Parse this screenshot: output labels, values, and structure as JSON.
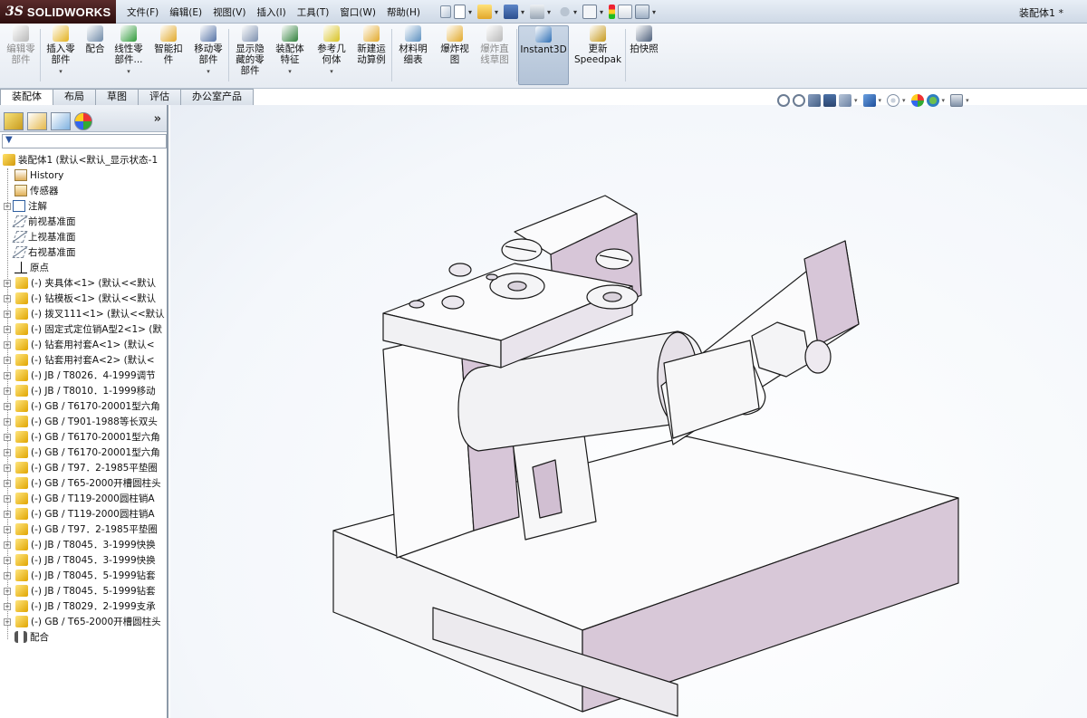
{
  "app": {
    "brand_prefix": "3S",
    "brand_name": "SOLIDWORKS",
    "document_title": "装配体1 *"
  },
  "menu": [
    "文件(F)",
    "编辑(E)",
    "视图(V)",
    "插入(I)",
    "工具(T)",
    "窗口(W)",
    "帮助(H)"
  ],
  "ribbon": {
    "buttons": [
      {
        "label": "编辑零\n部件",
        "enabled": false,
        "icon": "edit-component-icon"
      },
      {
        "label": "插入零\n部件",
        "enabled": true,
        "icon": "insert-component-icon",
        "dropdown": true
      },
      {
        "label": "配合",
        "enabled": true,
        "icon": "mate-icon"
      },
      {
        "label": "线性零\n部件...",
        "enabled": true,
        "icon": "linear-pattern-icon",
        "dropdown": true
      },
      {
        "label": "智能扣\n件",
        "enabled": true,
        "icon": "smart-fasteners-icon"
      },
      {
        "label": "移动零\n部件",
        "enabled": true,
        "icon": "move-component-icon",
        "dropdown": true
      },
      {
        "label": "显示隐\n藏的零\n部件",
        "enabled": true,
        "icon": "show-hidden-icon"
      },
      {
        "label": "装配体\n特征",
        "enabled": true,
        "icon": "assembly-features-icon",
        "dropdown": true
      },
      {
        "label": "参考几\n何体",
        "enabled": true,
        "icon": "reference-geometry-icon",
        "dropdown": true
      },
      {
        "label": "新建运\n动算例",
        "enabled": true,
        "icon": "new-motion-study-icon"
      },
      {
        "label": "材料明\n细表",
        "enabled": true,
        "icon": "bom-icon"
      },
      {
        "label": "爆炸视\n图",
        "enabled": true,
        "icon": "exploded-view-icon"
      },
      {
        "label": "爆炸直\n线草图",
        "enabled": false,
        "icon": "explode-line-sketch-icon"
      },
      {
        "label": "Instant3D",
        "enabled": true,
        "active": true,
        "icon": "instant3d-icon"
      },
      {
        "label": "更新\nSpeedpak",
        "enabled": true,
        "icon": "update-speedpak-icon"
      },
      {
        "label": "拍快照",
        "enabled": true,
        "icon": "snapshot-icon"
      }
    ]
  },
  "tabs": [
    {
      "label": "装配体",
      "active": true
    },
    {
      "label": "布局",
      "active": false
    },
    {
      "label": "草图",
      "active": false
    },
    {
      "label": "评估",
      "active": false
    },
    {
      "label": "办公室产品",
      "active": false
    }
  ],
  "panel": {
    "expand_glyph": "»",
    "filter_glyph": "▼",
    "tree": [
      {
        "label": "装配体1 (默认<默认_显示状态-1",
        "type": "root",
        "icon": "assembly-icon"
      },
      {
        "label": "History",
        "type": "history",
        "icon": "history-icon"
      },
      {
        "label": "传感器",
        "type": "sensor",
        "icon": "sensor-icon"
      },
      {
        "label": "注解",
        "type": "annotation",
        "icon": "annotation-icon",
        "expand": true
      },
      {
        "label": "前视基准面",
        "type": "plane",
        "icon": "plane-icon"
      },
      {
        "label": "上视基准面",
        "type": "plane",
        "icon": "plane-icon"
      },
      {
        "label": "右视基准面",
        "type": "plane",
        "icon": "plane-icon"
      },
      {
        "label": "原点",
        "type": "origin",
        "icon": "origin-icon"
      },
      {
        "label": "(-) 夹具体<1> (默认<<默认",
        "type": "part",
        "icon": "part-icon",
        "expand": true
      },
      {
        "label": "(-) 钻模板<1> (默认<<默认",
        "type": "part",
        "icon": "part-icon",
        "expand": true
      },
      {
        "label": "(-) 拨叉111<1> (默认<<默认",
        "type": "part",
        "icon": "part-icon",
        "expand": true
      },
      {
        "label": "(-) 固定式定位销A型2<1> (默",
        "type": "part",
        "icon": "part-icon",
        "expand": true
      },
      {
        "label": "(-) 钻套用衬套A<1> (默认<",
        "type": "part",
        "icon": "part-icon",
        "expand": true
      },
      {
        "label": "(-) 钻套用衬套A<2> (默认<",
        "type": "part",
        "icon": "part-icon",
        "expand": true
      },
      {
        "label": "(-) JB / T8026．4-1999调节",
        "type": "part",
        "icon": "part-icon",
        "expand": true
      },
      {
        "label": "(-) JB / T8010．1-1999移动",
        "type": "part",
        "icon": "part-icon",
        "expand": true
      },
      {
        "label": "(-) GB / T6170-20001型六角",
        "type": "part",
        "icon": "part-icon",
        "expand": true
      },
      {
        "label": "(-) GB / T901-1988等长双头",
        "type": "part",
        "icon": "part-icon",
        "expand": true
      },
      {
        "label": "(-) GB / T6170-20001型六角",
        "type": "part",
        "icon": "part-icon",
        "expand": true
      },
      {
        "label": "(-) GB / T6170-20001型六角",
        "type": "part",
        "icon": "part-icon",
        "expand": true
      },
      {
        "label": "(-) GB / T97．2-1985平垫圈",
        "type": "part",
        "icon": "part-icon",
        "expand": true
      },
      {
        "label": "(-) GB / T65-2000开槽圆柱头",
        "type": "part",
        "icon": "part-icon",
        "expand": true
      },
      {
        "label": "(-) GB / T119-2000圆柱销A",
        "type": "part",
        "icon": "part-icon",
        "expand": true
      },
      {
        "label": "(-) GB / T119-2000圆柱销A",
        "type": "part",
        "icon": "part-icon",
        "expand": true
      },
      {
        "label": "(-) GB / T97．2-1985平垫圈",
        "type": "part",
        "icon": "part-icon",
        "expand": true
      },
      {
        "label": "(-) JB / T8045．3-1999快换",
        "type": "part",
        "icon": "part-icon",
        "expand": true
      },
      {
        "label": "(-) JB / T8045．3-1999快换",
        "type": "part",
        "icon": "part-icon",
        "expand": true
      },
      {
        "label": "(-) JB / T8045．5-1999钻套",
        "type": "part",
        "icon": "part-icon",
        "expand": true
      },
      {
        "label": "(-) JB / T8045．5-1999钻套",
        "type": "part",
        "icon": "part-icon",
        "expand": true
      },
      {
        "label": "(-) JB / T8029．2-1999支承",
        "type": "part",
        "icon": "part-icon",
        "expand": true
      },
      {
        "label": "(-) GB / T65-2000开槽圆柱头",
        "type": "part",
        "icon": "part-icon",
        "expand": true
      },
      {
        "label": "配合",
        "type": "mates",
        "icon": "mates-icon"
      }
    ]
  },
  "colors": {
    "body_white": "#f7f7f8",
    "body_shade": "#c9b8c9",
    "edge": "#1a1a1a",
    "part_icon": "#e8b800"
  }
}
